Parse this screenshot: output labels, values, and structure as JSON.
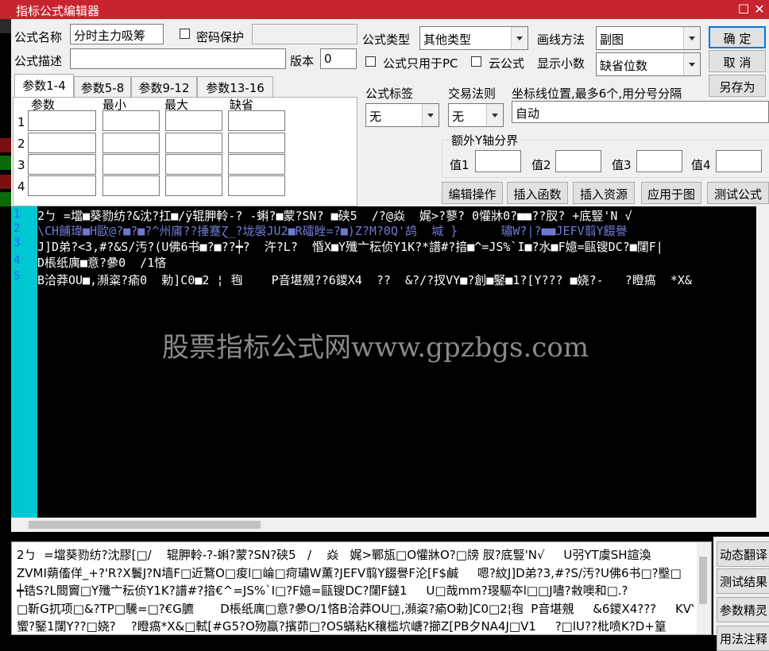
{
  "window": {
    "title": "指标公式编辑器",
    "restore_glyph": "☐",
    "close_glyph": "✕"
  },
  "form": {
    "name_label": "公式名称",
    "name_value": "分时主力吸筹",
    "password_label": "密码保护",
    "desc_label": "公式描述",
    "desc_value": "",
    "version_label": "版本",
    "version_value": "0",
    "type_label": "公式类型",
    "type_value": "其他类型",
    "draw_label": "画线方法",
    "draw_value": "副图",
    "pc_only_label": "公式只用于PC",
    "cloud_label": "云公式",
    "decimals_label": "显示小数",
    "decimals_value": "缺省位数",
    "tag_label": "公式标签",
    "tag_value": "无",
    "trade_rule_label": "交易法则",
    "trade_rule_value": "无",
    "coord_label": "坐标线位置,最多6个,用分号分隔",
    "coord_value": "自动",
    "extra_y_label": "额外Y轴分界",
    "y_labels": [
      "值1",
      "值2",
      "值3",
      "值4"
    ]
  },
  "buttons": {
    "ok": "确  定",
    "cancel": "取  消",
    "save_as": "另存为",
    "edit_ops": "编辑操作",
    "insert_func": "插入函数",
    "insert_res": "插入资源",
    "apply_chart": "应用于图",
    "test_formula": "测试公式"
  },
  "param_tabs": [
    "参数1-4",
    "参数5-8",
    "参数9-12",
    "参数13-16"
  ],
  "param_headers": [
    "参数",
    "最小",
    "最大",
    "缺省"
  ],
  "param_rows": [
    "1",
    "2",
    "3",
    "4"
  ],
  "editor": {
    "line_numbers": [
      "1",
      "2",
      "3",
      "4",
      "5"
    ],
    "lines": [
      "2ㄅ =壋■葵勠纺?&沈?扛■/ÿ辊胛軨-? -蝌?■蒙?SN? ■硖5  /?@焱  娓>?蓼? 0懽牀0?■■??肞? +底豎'N √",
      "\\CH餔瑋■H歐@?■?■?^州庯??捶蹇Ɀ_?垅褩JU2■R礌睉=?■)Z?M?0Q'鸪  堿 }      璛W?|?■■JEFV翦Y餟譽",
      "J]D弟?<3,#?&S/汚?(U佛6书■?■??┿?  汻?L?  惛X■Y殲亠秐侦Y1K?*譜#?揞■^=JS%`I■?⽔■F嬑=甌锼DC?■闥F|",
      "D棖纸庽■意?曑0  /1悋",
      "B洽莽OU■,瀕粢?瘉0  勅]C0■2 ¦ 毥    P音堪覫??6鑁X4  ??  &?/?扠VY■?創■鋻■1?[Y??? ■娆?-   ?瞪瘑  *X&"
    ],
    "watermark": "股票指标公式网www.gpzbgs.com"
  },
  "output": {
    "lines": [
      "2ㄅ  =壋葵勠纺?沈膠[□/    辊胛軨-?-蝌?蒙?SN?硖5   /    焱   娓>鄲瓬□O懽牀O?□牓 肞?底豎'N√     U弜YT虞SH諠渙",
      "ZVMI蒴傗佯_+?'R?X鬟J?N墙F□近鶩O□痠l□崘□疴璛W薫?JEFV翦Y餟譽F沦[F$鹹     嗯?紋J]D弟?3,#?S/汚?U佛6书□?壂□",
      "┿锆S?L閸竇□Y殲亠秐侦Y1K?譜#?揞€^=JS%`I□?F嬑=甌锼DC?闥F鐽1     U□哉mm?琝驅夲l□□J嚍?敹噢和□.?",
      "□靳G扤项□&?TP□驣=□?€G臕       D棖纸庽□意?曑O/1悋B洽莽OU□,瀕粢?瘉O勅]C0□2¦毥  P音堪覫     &6鑁X4???     KVY",
      "蠁?鋻1闥Y??□娆?    ?瞪瘑*X&□軾[#G5?O歾蠃?擯茆□?OS蟎粘K穰槛坹嵣?擳Z[PB夕NA4J□V1     ?□lU??枇喷K?D+篁"
    ]
  },
  "side_buttons": [
    "动态翻译",
    "测试结果",
    "参数精灵",
    "用法注释"
  ],
  "colors": {
    "titlebar": "#c8242f",
    "editor_bg": "#000000",
    "gutter": "#00c8d2",
    "line_number": "#1e6cf0",
    "green_digit": "#00c800",
    "orange_digit": "#f0a000",
    "blue_js": "#1e90ff",
    "watermark": "#8a8a8a"
  }
}
